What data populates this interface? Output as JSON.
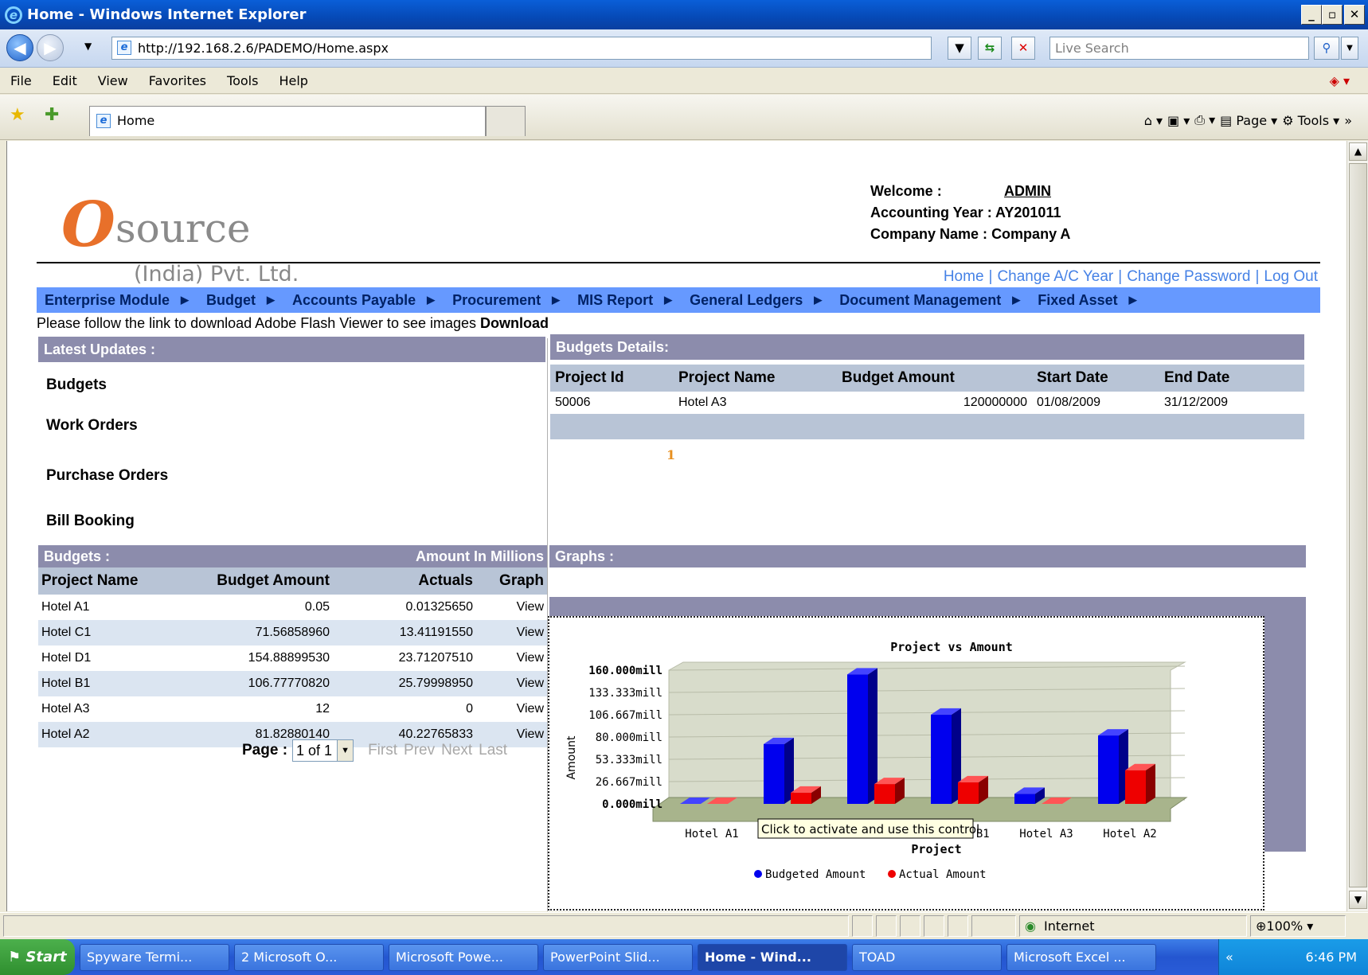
{
  "window": {
    "title": "Home - Windows Internet Explorer"
  },
  "address": {
    "url": "http://192.168.2.6/PADEMO/Home.aspx",
    "search_placeholder": "Live Search"
  },
  "menu": [
    "File",
    "Edit",
    "View",
    "Favorites",
    "Tools",
    "Help"
  ],
  "tab": {
    "label": "Home"
  },
  "command_bar": {
    "page": "Page",
    "tools": "Tools"
  },
  "logo": {
    "letter": "O",
    "word": "source",
    "sub": "(India) Pvt. Ltd."
  },
  "welcome": {
    "welcome_label": "Welcome :",
    "user": "ADMIN",
    "year_label": "Accounting Year :",
    "year": "AY201011",
    "company_label": "Company Name :",
    "company": "Company A"
  },
  "top_links": [
    "Home",
    "Change A/C Year",
    "Change Password",
    "Log Out"
  ],
  "main_menu": [
    "Enterprise Module",
    "Budget",
    "Accounts Payable",
    "Procurement",
    "MIS Report",
    "General Ledgers",
    "Document Management",
    "Fixed Asset"
  ],
  "flash": {
    "message": "Please follow the link to download Adobe Flash Viewer to see images",
    "link": "Download"
  },
  "latest_updates": {
    "title": "Latest Updates :",
    "items": [
      "Budgets",
      "Work Orders",
      "Purchase Orders",
      "Bill Booking"
    ]
  },
  "budget_details": {
    "title": "Budgets Details:",
    "headers": [
      "Project Id",
      "Project Name",
      "Budget Amount",
      "Start Date",
      "End Date"
    ],
    "row": [
      "50006",
      "Hotel A3",
      "120000000",
      "01/08/2009",
      "31/12/2009"
    ],
    "page": "1"
  },
  "budgets": {
    "title": "Budgets :",
    "units": "Amount In Millions",
    "headers": [
      "Project Name",
      "Budget Amount",
      "Actuals",
      "Graph"
    ],
    "rows": [
      [
        "Hotel A1",
        "0.05",
        "0.01325650",
        "View"
      ],
      [
        "Hotel C1",
        "71.56858960",
        "13.41191550",
        "View"
      ],
      [
        "Hotel D1",
        "154.88899530",
        "23.71207510",
        "View"
      ],
      [
        "Hotel B1",
        "106.77770820",
        "25.79998950",
        "View"
      ],
      [
        "Hotel A3",
        "12",
        "0",
        "View"
      ],
      [
        "Hotel A2",
        "81.82880140",
        "40.22765833",
        "View"
      ]
    ],
    "pager": {
      "label": "Page :",
      "selected": "1 of 1",
      "first": "First",
      "prev": "Prev",
      "next": "Next",
      "last": "Last"
    }
  },
  "graphs": {
    "title": "Graphs :"
  },
  "chart_data": {
    "type": "bar",
    "title": "Project vs Amount",
    "xlabel": "Project",
    "ylabel": "Amount",
    "categories": [
      "Hotel A1",
      "Hotel C1",
      "Hotel D1",
      "Hotel B1",
      "Hotel A3",
      "Hotel A2"
    ],
    "series": [
      {
        "name": "Budgeted Amount",
        "values": [
          0.05,
          71.57,
          154.89,
          106.78,
          12,
          81.83
        ],
        "color": "#0000ee"
      },
      {
        "name": "Actual Amount",
        "values": [
          0.013,
          13.41,
          23.71,
          25.8,
          0,
          40.23
        ],
        "color": "#ee0000"
      }
    ],
    "y_ticks": [
      "0.000mill",
      "26.667mill",
      "53.333mill",
      "80.000mill",
      "106.667mill",
      "133.333mill",
      "160.000mill"
    ],
    "ylim": [
      0,
      160
    ],
    "tooltip": "Click to activate and use this control",
    "legend_position": "bottom"
  },
  "status": {
    "zone": "Internet",
    "zoom": "100%"
  },
  "taskbar": {
    "start": "Start",
    "tasks": [
      "Spyware Termi...",
      "2 Microsoft O...",
      "Microsoft Powe...",
      "PowerPoint Slid...",
      "Home - Wind...",
      "TOAD",
      "Microsoft Excel ..."
    ],
    "clock": "6:46 PM"
  }
}
